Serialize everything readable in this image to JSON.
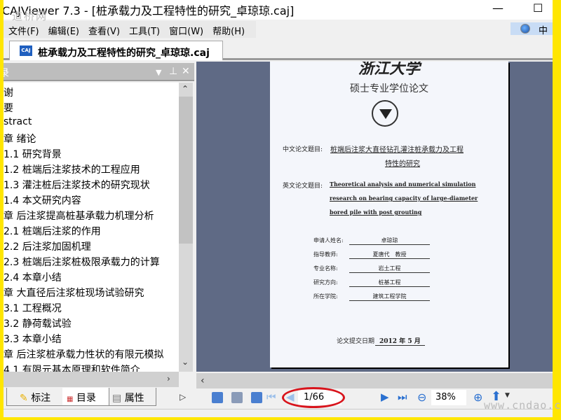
{
  "window": {
    "title": "CAJViewer 7.3 - [桩承载力及工程特性的研究_卓琼琼.caj]",
    "minimize": "—",
    "maximize": "☐"
  },
  "watermark_top": "道桥网",
  "watermark_bottom": "www.cndao.com",
  "menu": [
    "文件(F)",
    "编辑(E)",
    "查看(V)",
    "工具(T)",
    "窗口(W)",
    "帮助(H)"
  ],
  "ime": {
    "label": "中"
  },
  "doc_tab": {
    "label": "桩承载力及工程特性的研究_卓琼琼.caj",
    "icon": "caj-file-icon"
  },
  "toc": {
    "header": "录",
    "items": [
      "谢",
      "要",
      "stract",
      "章 绪论",
      "1.1 研究背景",
      "1.2 桩端后注浆技术的工程应用",
      "1.3 灌注桩后注浆技术的研究现状",
      "1.4 本文研究内容",
      "章 后注浆提高桩基承载力机理分析",
      "2.1 桩端后注浆的作用",
      "2.2 后注浆加固机理",
      "2.3 桩端后注浆桩极限承载力的计算",
      "2.4 本章小结",
      "章 大直径后注浆桩现场试验研究",
      "3.1 工程概况",
      "3.2 静荷载试验",
      "3.3 本章小结",
      "章 后注浆桩承载力性状的有限元模拟",
      "4.1 有限元基本原理和软件简介"
    ]
  },
  "left_tabs": [
    "标注",
    "目录",
    "属性"
  ],
  "page": {
    "university": "浙江大学",
    "degree": "硕士专业学位论文",
    "cn_title_label": "中文论文题目:",
    "cn_title_1": "桩端后注浆大直径钻孔灌注桩承载力及工程",
    "cn_title_2": "特性的研究",
    "en_title_label": "英文论文题目:",
    "en_title_1": "Theoretical analysis and numerical simulation",
    "en_title_2": "research on bearing capacity of large-diameter",
    "en_title_3": "bored pile with post grouting",
    "fields": [
      {
        "label": "申请人姓名:",
        "value": "卓琼琼"
      },
      {
        "label": "指导教师:",
        "value": "夏唐代　教授"
      },
      {
        "label": "专业名称:",
        "value": "岩土工程"
      },
      {
        "label": "研究方向:",
        "value": "桩基工程"
      },
      {
        "label": "所在学院:",
        "value": "建筑工程学院"
      }
    ],
    "date_label": "论文提交日期",
    "date_value": "2012 年 5 月"
  },
  "toolbar": {
    "page_indicator": "1/66",
    "zoom": "38%",
    "highlight_color": "#d8141c"
  }
}
